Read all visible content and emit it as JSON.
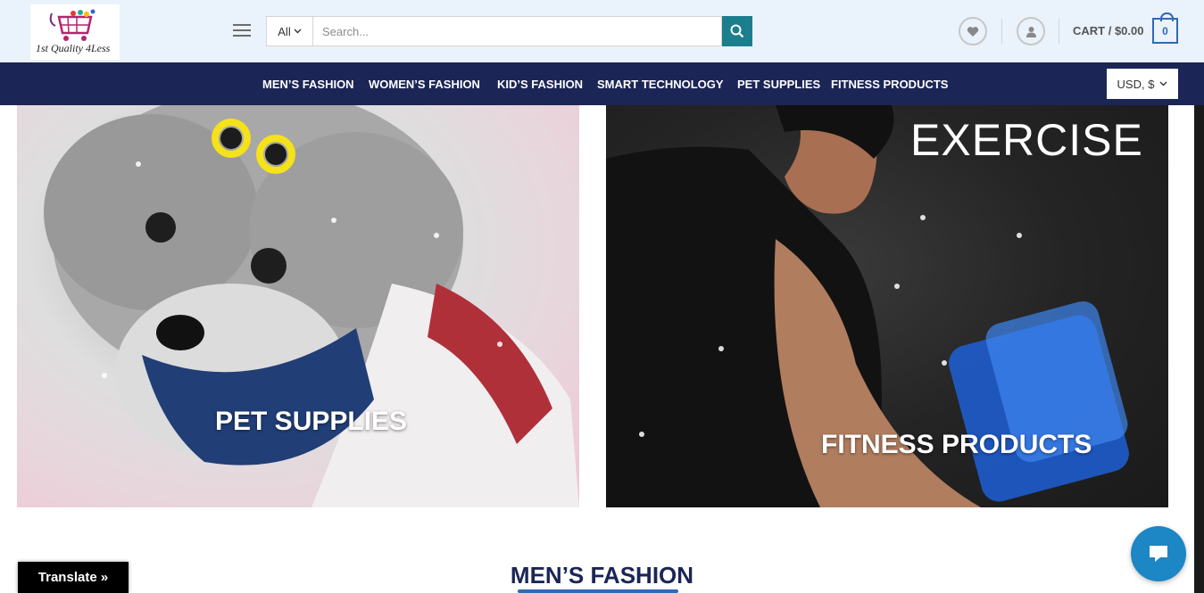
{
  "header": {
    "logo_text": "1st Quality 4Less",
    "search": {
      "category": "All",
      "placeholder": "Search..."
    },
    "cart_label": "CART / $0.00",
    "cart_count": "0"
  },
  "nav": {
    "items": [
      "MEN’S FASHION",
      "WOMEN’S FASHION",
      "KID’S FASHION",
      "SMART TECHNOLOGY",
      "PET SUPPLIES",
      "FITNESS PRODUCTS"
    ],
    "currency": "USD, $"
  },
  "banners": {
    "pet": {
      "caption": "PET SUPPLIES"
    },
    "fitness": {
      "headline": "EXERCISE",
      "caption": "FITNESS PRODUCTS"
    }
  },
  "section": {
    "title": "MEN’S FASHION"
  },
  "translate": {
    "label": "Translate »"
  },
  "icons": {
    "menu": "hamburger-icon",
    "search": "search-icon",
    "wishlist": "heart-icon",
    "account": "user-icon",
    "chat": "chat-icon"
  },
  "colors": {
    "header_bg": "#eaf2fb",
    "nav_bg": "#1b2556",
    "search_button": "#1c7d8c",
    "accent_blue": "#2f6ab3",
    "chat_button": "#1d86c4"
  }
}
